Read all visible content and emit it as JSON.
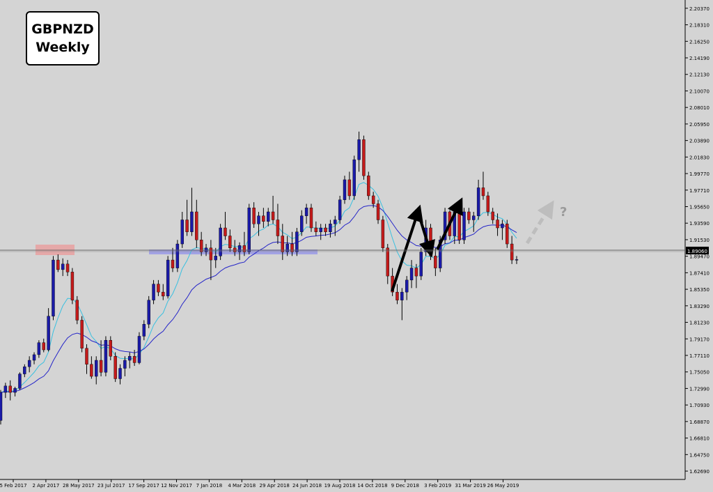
{
  "chart_data": {
    "type": "candlestick",
    "symbol": "GBPNZD",
    "timeframe": "Weekly",
    "current_price": "1.89060",
    "y_ticks": [
      "2.20370",
      "2.18310",
      "2.16250",
      "2.14190",
      "2.12130",
      "2.10070",
      "2.08010",
      "2.05950",
      "2.03890",
      "2.01830",
      "1.99770",
      "1.97710",
      "1.95650",
      "1.93590",
      "1.91530",
      "1.89470",
      "1.87410",
      "1.85350",
      "1.83290",
      "1.81230",
      "1.79170",
      "1.77110",
      "1.75050",
      "1.72990",
      "1.70930",
      "1.68870",
      "1.66810",
      "1.64750",
      "1.62690"
    ],
    "x_ticks": [
      "5 Feb 2017",
      "2 Apr 2017",
      "28 May 2017",
      "23 Jul 2017",
      "17 Sep 2017",
      "12 Nov 2017",
      "7 Jan 2018",
      "4 Mar 2018",
      "29 Apr 2018",
      "24 Jun 2018",
      "19 Aug 2018",
      "14 Oct 2018",
      "9 Dec 2018",
      "3 Feb 2019",
      "31 Mar 2019",
      "26 May 2019"
    ],
    "ylim": [
      1.6165,
      2.214
    ],
    "question_mark": "?",
    "colors": {
      "background": "#d4d4d4",
      "bull": "#1a1aa8",
      "bear": "#c41a1a",
      "ma_fast": "#38c0e0",
      "ma_slow": "#2424c8",
      "resistance_zone": "#e8a0a0",
      "support_zone": "#9999e6",
      "arrow": "#000000",
      "forecast_arrow": "#bdbdbd"
    },
    "candles": [
      [
        1.69,
        1.728,
        1.685,
        1.725
      ],
      [
        1.725,
        1.737,
        1.718,
        1.733
      ],
      [
        1.733,
        1.74,
        1.715,
        1.725
      ],
      [
        1.725,
        1.732,
        1.72,
        1.73
      ],
      [
        1.73,
        1.75,
        1.728,
        1.748
      ],
      [
        1.748,
        1.76,
        1.744,
        1.757
      ],
      [
        1.757,
        1.77,
        1.75,
        1.765
      ],
      [
        1.765,
        1.775,
        1.76,
        1.772
      ],
      [
        1.772,
        1.79,
        1.768,
        1.787
      ],
      [
        1.787,
        1.792,
        1.775,
        1.778
      ],
      [
        1.778,
        1.83,
        1.776,
        1.82
      ],
      [
        1.82,
        1.895,
        1.815,
        1.89
      ],
      [
        1.89,
        1.897,
        1.875,
        1.878
      ],
      [
        1.878,
        1.892,
        1.87,
        1.885
      ],
      [
        1.885,
        1.89,
        1.87,
        1.875
      ],
      [
        1.875,
        1.88,
        1.835,
        1.84
      ],
      [
        1.84,
        1.845,
        1.81,
        1.815
      ],
      [
        1.815,
        1.82,
        1.775,
        1.78
      ],
      [
        1.78,
        1.785,
        1.748,
        1.76
      ],
      [
        1.76,
        1.77,
        1.742,
        1.745
      ],
      [
        1.745,
        1.77,
        1.735,
        1.765
      ],
      [
        1.765,
        1.79,
        1.745,
        1.75
      ],
      [
        1.75,
        1.795,
        1.745,
        1.79
      ],
      [
        1.79,
        1.795,
        1.765,
        1.77
      ],
      [
        1.77,
        1.775,
        1.738,
        1.742
      ],
      [
        1.742,
        1.76,
        1.735,
        1.755
      ],
      [
        1.755,
        1.77,
        1.745,
        1.765
      ],
      [
        1.765,
        1.775,
        1.755,
        1.77
      ],
      [
        1.77,
        1.778,
        1.758,
        1.762
      ],
      [
        1.762,
        1.8,
        1.76,
        1.795
      ],
      [
        1.795,
        1.815,
        1.79,
        1.81
      ],
      [
        1.81,
        1.845,
        1.805,
        1.84
      ],
      [
        1.84,
        1.865,
        1.835,
        1.86
      ],
      [
        1.86,
        1.865,
        1.845,
        1.85
      ],
      [
        1.85,
        1.86,
        1.84,
        1.845
      ],
      [
        1.845,
        1.895,
        1.842,
        1.89
      ],
      [
        1.89,
        1.905,
        1.875,
        1.88
      ],
      [
        1.88,
        1.915,
        1.875,
        1.91
      ],
      [
        1.91,
        1.95,
        1.905,
        1.94
      ],
      [
        1.94,
        1.965,
        1.92,
        1.925
      ],
      [
        1.925,
        1.98,
        1.92,
        1.95
      ],
      [
        1.95,
        1.965,
        1.905,
        1.915
      ],
      [
        1.915,
        1.925,
        1.895,
        1.9
      ],
      [
        1.9,
        1.91,
        1.895,
        1.905
      ],
      [
        1.905,
        1.915,
        1.865,
        1.89
      ],
      [
        1.89,
        1.905,
        1.88,
        1.895
      ],
      [
        1.895,
        1.935,
        1.89,
        1.93
      ],
      [
        1.93,
        1.95,
        1.915,
        1.92
      ],
      [
        1.92,
        1.928,
        1.9,
        1.905
      ],
      [
        1.905,
        1.915,
        1.895,
        1.9
      ],
      [
        1.9,
        1.912,
        1.89,
        1.908
      ],
      [
        1.908,
        1.925,
        1.895,
        1.9
      ],
      [
        1.9,
        1.96,
        1.897,
        1.955
      ],
      [
        1.955,
        1.962,
        1.93,
        1.935
      ],
      [
        1.935,
        1.95,
        1.92,
        1.945
      ],
      [
        1.945,
        1.955,
        1.93,
        1.938
      ],
      [
        1.938,
        1.955,
        1.932,
        1.95
      ],
      [
        1.95,
        1.97,
        1.935,
        1.94
      ],
      [
        1.94,
        1.96,
        1.91,
        1.92
      ],
      [
        1.92,
        1.935,
        1.89,
        1.9
      ],
      [
        1.9,
        1.92,
        1.895,
        1.91
      ],
      [
        1.91,
        1.925,
        1.895,
        1.9
      ],
      [
        1.9,
        1.93,
        1.895,
        1.925
      ],
      [
        1.925,
        1.952,
        1.92,
        1.945
      ],
      [
        1.945,
        1.96,
        1.935,
        1.955
      ],
      [
        1.955,
        1.96,
        1.925,
        1.93
      ],
      [
        1.93,
        1.938,
        1.92,
        1.925
      ],
      [
        1.925,
        1.935,
        1.915,
        1.93
      ],
      [
        1.93,
        1.935,
        1.92,
        1.925
      ],
      [
        1.925,
        1.94,
        1.918,
        1.935
      ],
      [
        1.935,
        1.945,
        1.92,
        1.94
      ],
      [
        1.94,
        1.97,
        1.935,
        1.965
      ],
      [
        1.965,
        1.995,
        1.96,
        1.99
      ],
      [
        1.99,
        2.0,
        1.965,
        1.97
      ],
      [
        1.97,
        2.02,
        1.965,
        2.015
      ],
      [
        2.015,
        2.05,
        2.0,
        2.04
      ],
      [
        2.04,
        2.045,
        1.99,
        1.995
      ],
      [
        1.995,
        2.0,
        1.965,
        1.97
      ],
      [
        1.97,
        1.975,
        1.955,
        1.96
      ],
      [
        1.96,
        1.965,
        1.935,
        1.94
      ],
      [
        1.94,
        1.945,
        1.9,
        1.905
      ],
      [
        1.905,
        1.91,
        1.86,
        1.87
      ],
      [
        1.87,
        1.88,
        1.845,
        1.85
      ],
      [
        1.85,
        1.86,
        1.835,
        1.84
      ],
      [
        1.84,
        1.855,
        1.815,
        1.85
      ],
      [
        1.85,
        1.87,
        1.84,
        1.865
      ],
      [
        1.865,
        1.89,
        1.855,
        1.88
      ],
      [
        1.88,
        1.885,
        1.855,
        1.87
      ],
      [
        1.87,
        1.905,
        1.865,
        1.9
      ],
      [
        1.9,
        1.94,
        1.895,
        1.93
      ],
      [
        1.93,
        1.935,
        1.89,
        1.895
      ],
      [
        1.895,
        1.905,
        1.87,
        1.88
      ],
      [
        1.88,
        1.92,
        1.875,
        1.915
      ],
      [
        1.915,
        1.955,
        1.91,
        1.95
      ],
      [
        1.95,
        1.952,
        1.915,
        1.92
      ],
      [
        1.92,
        1.955,
        1.91,
        1.95
      ],
      [
        1.95,
        1.955,
        1.91,
        1.915
      ],
      [
        1.915,
        1.955,
        1.91,
        1.95
      ],
      [
        1.95,
        1.955,
        1.935,
        1.94
      ],
      [
        1.94,
        1.95,
        1.925,
        1.945
      ],
      [
        1.945,
        1.99,
        1.94,
        1.98
      ],
      [
        1.98,
        2.0,
        1.965,
        1.97
      ],
      [
        1.97,
        1.975,
        1.945,
        1.95
      ],
      [
        1.95,
        1.955,
        1.935,
        1.94
      ],
      [
        1.94,
        1.948,
        1.92,
        1.93
      ],
      [
        1.93,
        1.94,
        1.915,
        1.935
      ],
      [
        1.935,
        1.94,
        1.905,
        1.91
      ],
      [
        1.91,
        1.92,
        1.885,
        1.89
      ],
      [
        1.89,
        1.895,
        1.885,
        1.8906
      ]
    ]
  }
}
